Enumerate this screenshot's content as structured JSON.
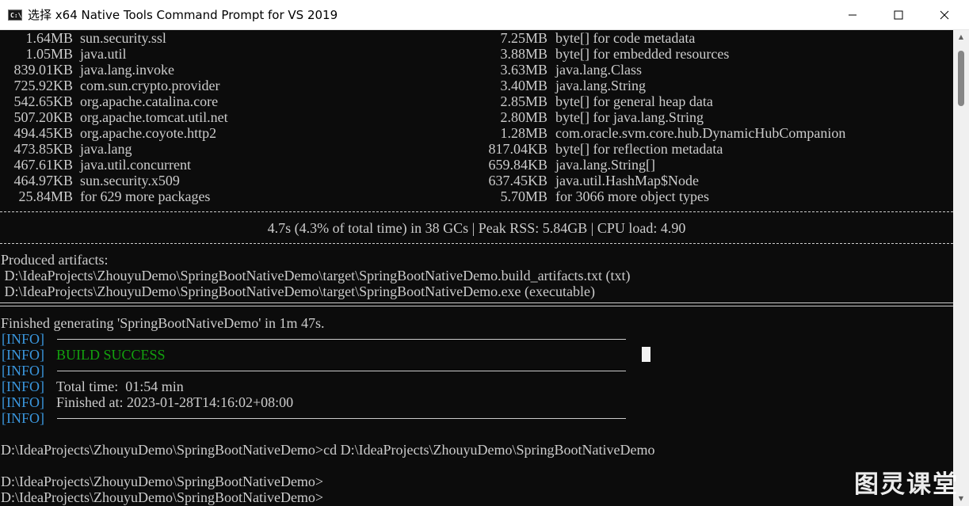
{
  "window": {
    "title": "选择 x64 Native Tools Command Prompt for VS 2019",
    "icon": "cmd-icon",
    "minimize": "minimize-icon",
    "maximize": "maximize-icon",
    "close": "close-icon"
  },
  "packages": [
    {
      "size": "1.64MB",
      "name": "sun.security.ssl"
    },
    {
      "size": "1.05MB",
      "name": "java.util"
    },
    {
      "size": "839.01KB",
      "name": "java.lang.invoke"
    },
    {
      "size": "725.92KB",
      "name": "com.sun.crypto.provider"
    },
    {
      "size": "542.65KB",
      "name": "org.apache.catalina.core"
    },
    {
      "size": "507.20KB",
      "name": "org.apache.tomcat.util.net"
    },
    {
      "size": "494.45KB",
      "name": "org.apache.coyote.http2"
    },
    {
      "size": "473.85KB",
      "name": "java.lang"
    },
    {
      "size": "467.61KB",
      "name": "java.util.concurrent"
    },
    {
      "size": "464.97KB",
      "name": "sun.security.x509"
    },
    {
      "size": "25.84MB",
      "name": "for 629 more packages"
    }
  ],
  "objects": [
    {
      "size": "7.25MB",
      "name": "byte[] for code metadata"
    },
    {
      "size": "3.88MB",
      "name": "byte[] for embedded resources"
    },
    {
      "size": "3.63MB",
      "name": "java.lang.Class"
    },
    {
      "size": "3.40MB",
      "name": "java.lang.String"
    },
    {
      "size": "2.85MB",
      "name": "byte[] for general heap data"
    },
    {
      "size": "2.80MB",
      "name": "byte[] for java.lang.String"
    },
    {
      "size": "1.28MB",
      "name": "com.oracle.svm.core.hub.DynamicHubCompanion"
    },
    {
      "size": "817.04KB",
      "name": "byte[] for reflection metadata"
    },
    {
      "size": "659.84KB",
      "name": "java.lang.String[]"
    },
    {
      "size": "637.45KB",
      "name": "java.util.HashMap$Node"
    },
    {
      "size": "5.70MB",
      "name": "for 3066 more object types"
    }
  ],
  "summary": "4.7s (4.3% of total time) in 38 GCs | Peak RSS: 5.84GB | CPU load: 4.90",
  "artifacts": {
    "heading": "Produced artifacts:",
    "items": [
      " D:\\IdeaProjects\\ZhouyuDemo\\SpringBootNativeDemo\\target\\SpringBootNativeDemo.build_artifacts.txt (txt)",
      " D:\\IdeaProjects\\ZhouyuDemo\\SpringBootNativeDemo\\target\\SpringBootNativeDemo.exe (executable)"
    ]
  },
  "finished": "Finished generating 'SpringBootNativeDemo' in 1m 47s.",
  "maven": {
    "tag": "[INFO]",
    "dashes": "--------------------------------------------------------------------------------",
    "build_status": "BUILD SUCCESS",
    "total_time": "Total time:  01:54 min",
    "finished_at": "Finished at: 2023-01-28T14:16:02+08:00"
  },
  "prompts": [
    "D:\\IdeaProjects\\ZhouyuDemo\\SpringBootNativeDemo>cd D:\\IdeaProjects\\ZhouyuDemo\\SpringBootNativeDemo",
    "D:\\IdeaProjects\\ZhouyuDemo\\SpringBootNativeDemo>",
    "D:\\IdeaProjects\\ZhouyuDemo\\SpringBootNativeDemo>"
  ],
  "watermark": "图灵课堂"
}
